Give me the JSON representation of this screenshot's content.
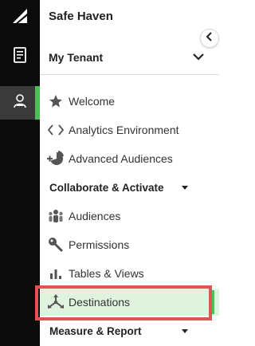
{
  "app": {
    "title": "Safe Haven"
  },
  "tenant": {
    "label": "My Tenant"
  },
  "nav": {
    "welcome": "Welcome",
    "analytics": "Analytics Environment",
    "advanced": "Advanced Audiences",
    "collab_section": "Collaborate & Activate",
    "audiences": "Audiences",
    "permissions": "Permissions",
    "tables": "Tables & Views",
    "destinations": "Destinations",
    "measure_section": "Measure & Report"
  },
  "icons": {
    "logo": "logo-icon",
    "rail_doc": "document-icon",
    "rail_user": "user-group-icon",
    "collapse": "chevron-left-icon",
    "tenant_chevron": "chevron-down-icon",
    "welcome": "star-icon",
    "analytics": "code-icon",
    "advanced": "pie-plus-icon",
    "audiences": "people-icon",
    "permissions": "key-icon",
    "tables": "bar-chart-icon",
    "destinations": "share-arrows-icon"
  },
  "colors": {
    "rail_bg": "#0b0b0b",
    "accent_green": "#4fbe57",
    "selected_bg": "#dff3de",
    "highlight_border": "#e25454"
  }
}
